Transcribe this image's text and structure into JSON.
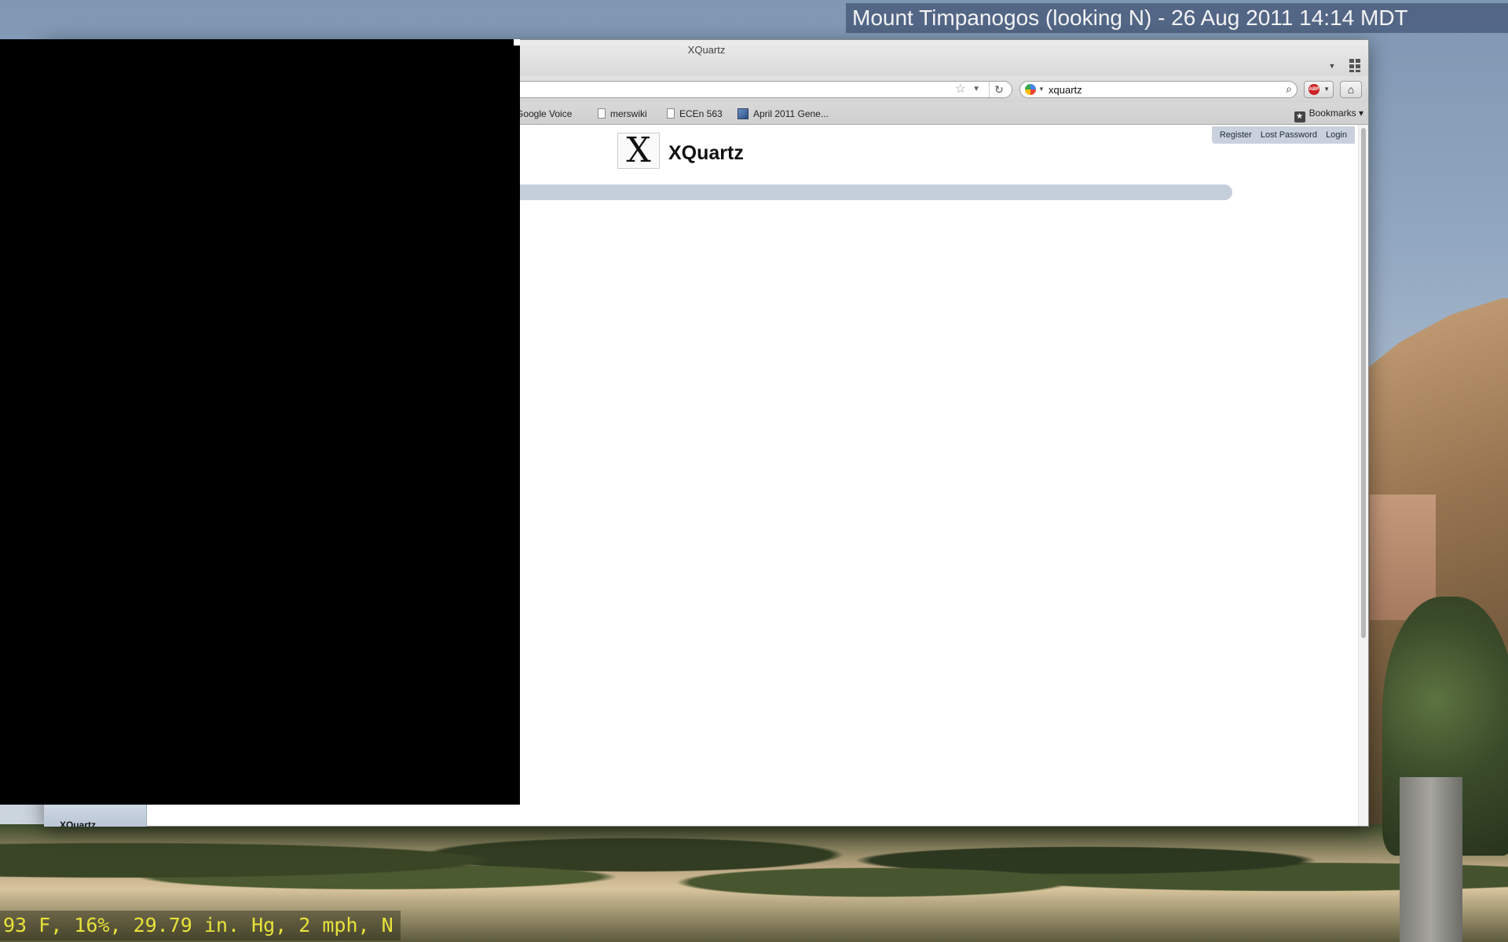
{
  "desktop": {
    "webcam_caption": "Mount Timpanogos (looking N) - 26 Aug 2011 14:14 MDT",
    "weather": "93 F, 16%, 29.79 in. Hg, 2 mph, N"
  },
  "window": {
    "title": "XQuartz",
    "icons": {
      "tab_list": "chevron-down-icon",
      "tab_groups": "grid-icon"
    }
  },
  "navbar": {
    "url_value": "",
    "search_value": "xquartz",
    "icons": [
      "star-icon",
      "history-dropdown-icon",
      "reload-icon",
      "search-engine-icon",
      "search-icon",
      "adblock-icon",
      "home-icon"
    ]
  },
  "bookmarks": {
    "items": [
      {
        "label": "Google Voice"
      },
      {
        "label": "merswiki"
      },
      {
        "label": "ECEn 563"
      },
      {
        "label": "April 2011 Gene..."
      }
    ],
    "menu_label": "Bookmarks"
  },
  "page": {
    "user_links": [
      "Register",
      "Lost Password",
      "Login"
    ],
    "logo_letter": "X",
    "site_title": "XQuartz"
  },
  "bottom_tab": {
    "label": "XQuartz"
  },
  "colors": {
    "nav_bar_bg": "#c5cfdb",
    "caption_bg": "#46587a",
    "weather_text": "#e8e23a"
  }
}
